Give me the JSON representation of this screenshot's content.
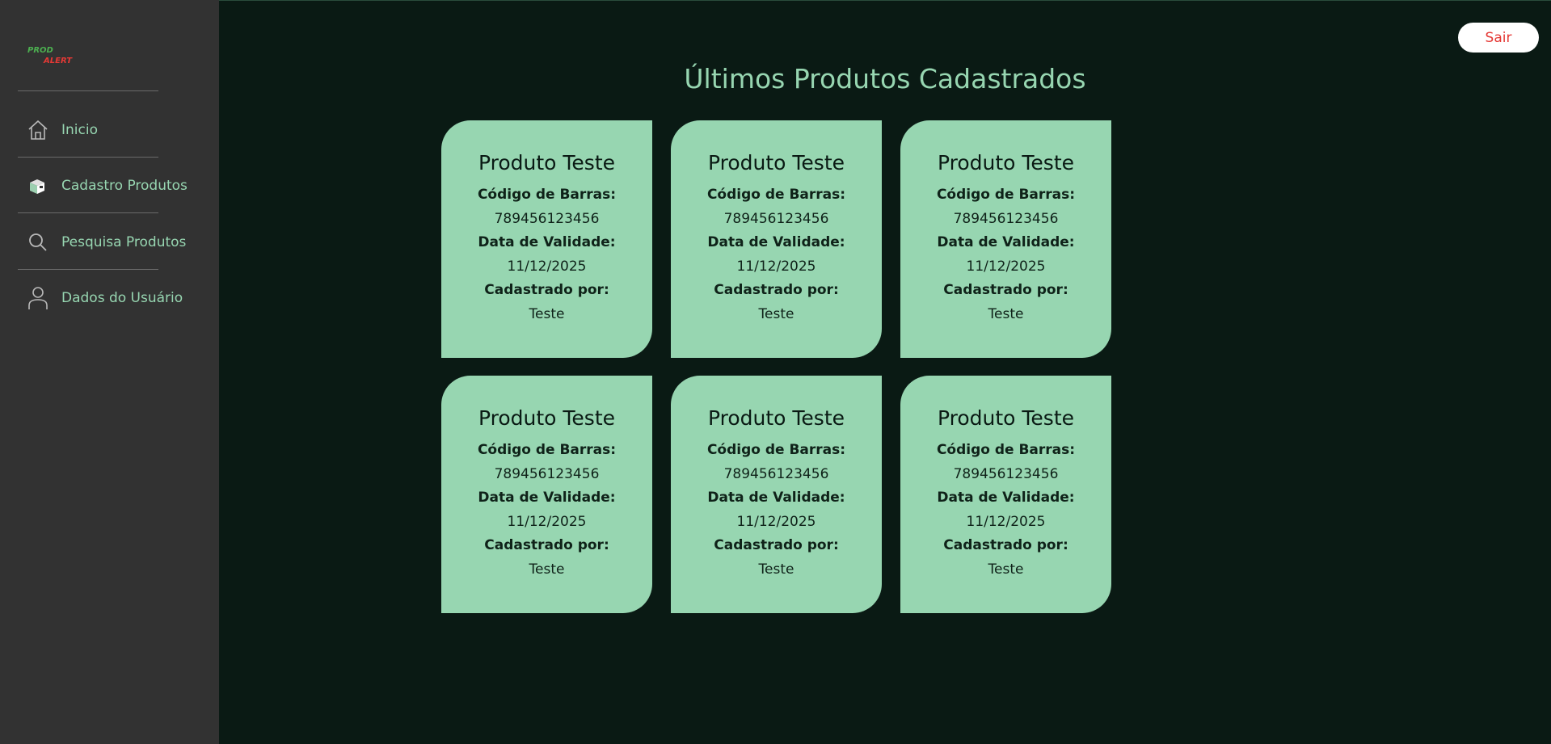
{
  "logo": {
    "line1": "PROD",
    "line2": "ALERT"
  },
  "sidebar": {
    "items": [
      {
        "label": "Inicio",
        "icon": "home-icon"
      },
      {
        "label": "Cadastro Produtos",
        "icon": "box-icon"
      },
      {
        "label": "Pesquisa Produtos",
        "icon": "search-icon"
      },
      {
        "label": "Dados do Usuário",
        "icon": "user-icon"
      }
    ]
  },
  "header": {
    "logout_label": "Sair"
  },
  "main": {
    "title": "Últimos Produtos Cadastrados",
    "products": [
      {
        "name": "Produto Teste",
        "barcode_label": "Código de Barras:",
        "barcode": "789456123456",
        "expiry_label": "Data de Validade:",
        "expiry": "11/12/2025",
        "registered_label": "Cadastrado por:",
        "registered_by": "Teste"
      },
      {
        "name": "Produto Teste",
        "barcode_label": "Código de Barras:",
        "barcode": "789456123456",
        "expiry_label": "Data de Validade:",
        "expiry": "11/12/2025",
        "registered_label": "Cadastrado por:",
        "registered_by": "Teste"
      },
      {
        "name": "Produto Teste",
        "barcode_label": "Código de Barras:",
        "barcode": "789456123456",
        "expiry_label": "Data de Validade:",
        "expiry": "11/12/2025",
        "registered_label": "Cadastrado por:",
        "registered_by": "Teste"
      },
      {
        "name": "Produto Teste",
        "barcode_label": "Código de Barras:",
        "barcode": "789456123456",
        "expiry_label": "Data de Validade:",
        "expiry": "11/12/2025",
        "registered_label": "Cadastrado por:",
        "registered_by": "Teste"
      },
      {
        "name": "Produto Teste",
        "barcode_label": "Código de Barras:",
        "barcode": "789456123456",
        "expiry_label": "Data de Validade:",
        "expiry": "11/12/2025",
        "registered_label": "Cadastrado por:",
        "registered_by": "Teste"
      },
      {
        "name": "Produto Teste",
        "barcode_label": "Código de Barras:",
        "barcode": "789456123456",
        "expiry_label": "Data de Validade:",
        "expiry": "11/12/2025",
        "registered_label": "Cadastrado por:",
        "registered_by": "Teste"
      }
    ]
  },
  "colors": {
    "background": "#0a1a14",
    "sidebar": "#323232",
    "accent": "#97d6b1",
    "logout_text": "#e53935"
  }
}
